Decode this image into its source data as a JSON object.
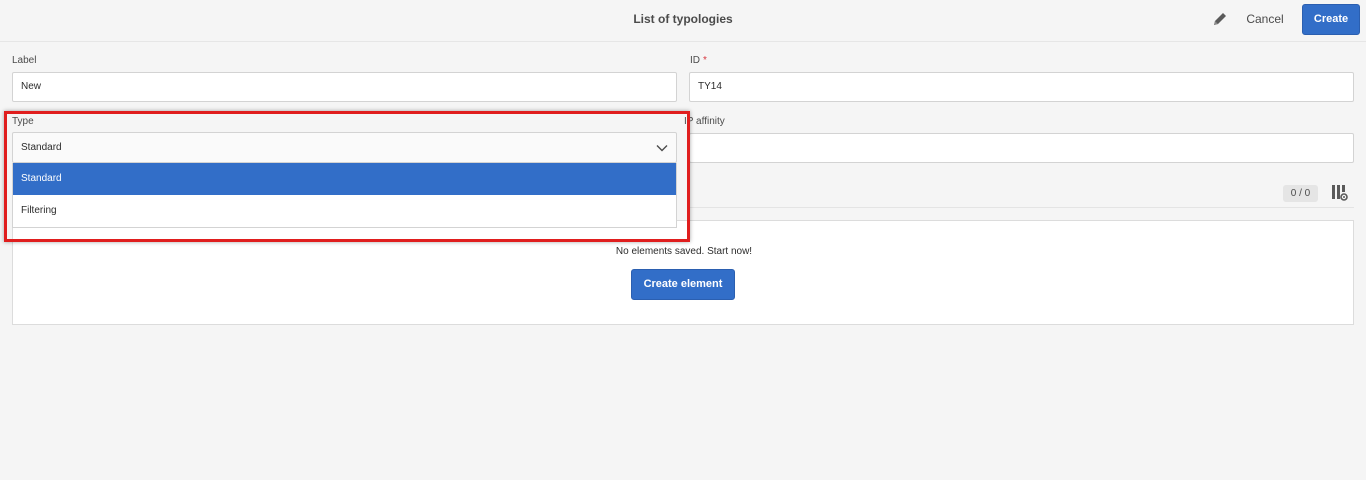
{
  "header": {
    "title": "List of typologies",
    "cancel_label": "Cancel",
    "create_label": "Create",
    "edit_icon": "pencil-icon"
  },
  "form": {
    "label_field": {
      "label": "Label",
      "value": "New"
    },
    "id_field": {
      "label": "ID",
      "required_mark": "*",
      "value": "TY14"
    },
    "type_field": {
      "label": "Type",
      "selected": "Standard",
      "options": [
        "Standard",
        "Filtering"
      ]
    },
    "ip_affinity_field": {
      "label": "IP affinity",
      "value": ""
    }
  },
  "rules": {
    "counter": "0 / 0",
    "columns_icon": "column-settings-icon",
    "empty_message": "No elements saved. Start now!",
    "create_element_label": "Create element"
  },
  "colors": {
    "accent": "#326ec8",
    "highlight": "#e01e1e",
    "required": "#d7373f"
  }
}
